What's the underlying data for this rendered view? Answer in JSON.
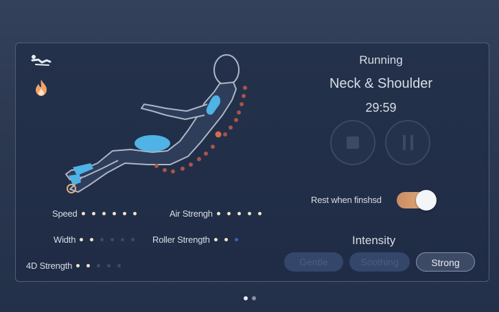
{
  "status": {
    "state": "Running",
    "program": "Neck & Shoulder",
    "timer": "29:59"
  },
  "controls": {
    "stop_icon": "stop-icon",
    "pause_icon": "pause-icon"
  },
  "icons": {
    "recline": "recline-icon",
    "heat": "flame-icon"
  },
  "rest_toggle": {
    "label": "Rest when finshsd",
    "on": true
  },
  "settings": [
    {
      "label": "Speed",
      "levels": 6,
      "active": 6,
      "style": "on"
    },
    {
      "label": "Air Strengh",
      "levels": 5,
      "active": 5,
      "style": "on"
    },
    {
      "label": "Width",
      "levels": 6,
      "active": 2,
      "style": "on"
    },
    {
      "label": "Roller Strength",
      "levels": 3,
      "active": 2,
      "style": "on-blue"
    },
    {
      "label": "4D Strength",
      "levels": 5,
      "active": 2,
      "style": "on"
    }
  ],
  "intensity": {
    "title": "Intensity",
    "modes": [
      {
        "label": "Gentle",
        "selected": false
      },
      {
        "label": "Soothing",
        "selected": false
      },
      {
        "label": "Strong",
        "selected": true
      }
    ]
  },
  "pager": {
    "pages": 2,
    "current": 1
  },
  "colors": {
    "accent": "#e7b184",
    "active_zone": "#4fb3e6",
    "roller_dot": "#c9614a",
    "panel_bg": "#22304a"
  }
}
